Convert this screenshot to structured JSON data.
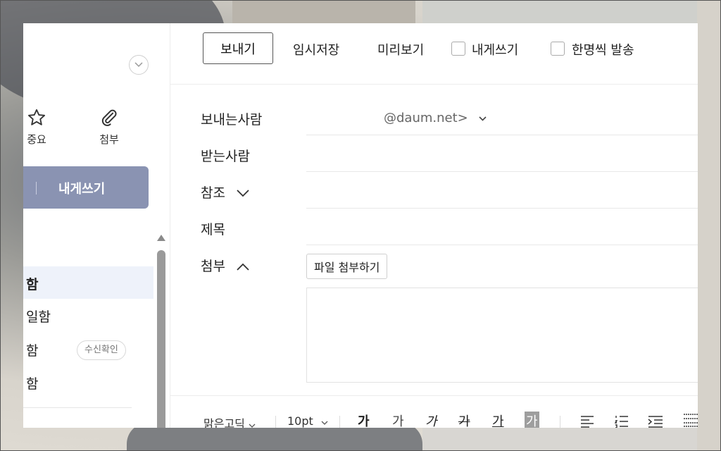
{
  "toolbar": {
    "send": "보내기",
    "draft": "임시저장",
    "preview": "미리보기",
    "to_me": "내게쓰기",
    "individual": "한명씩 발송"
  },
  "sidebar": {
    "important": "중요",
    "attachment": "첨부",
    "compose_me": "내게쓰기",
    "folders": [
      "함",
      "일함",
      "함",
      "함"
    ],
    "read_receipt": "수신확인",
    "compose_button_color": "#8a93b2"
  },
  "form": {
    "from_label": "보내는사람",
    "from_value": "@daum.net>",
    "to_label": "받는사람",
    "cc_label": "참조",
    "subject_label": "제목",
    "attach_label": "첨부",
    "attach_button": "파일 첨부하기"
  },
  "editor": {
    "font": "맑은고딕",
    "size": "10pt",
    "formats": [
      "가",
      "가",
      "가",
      "가",
      "가",
      "가"
    ]
  }
}
